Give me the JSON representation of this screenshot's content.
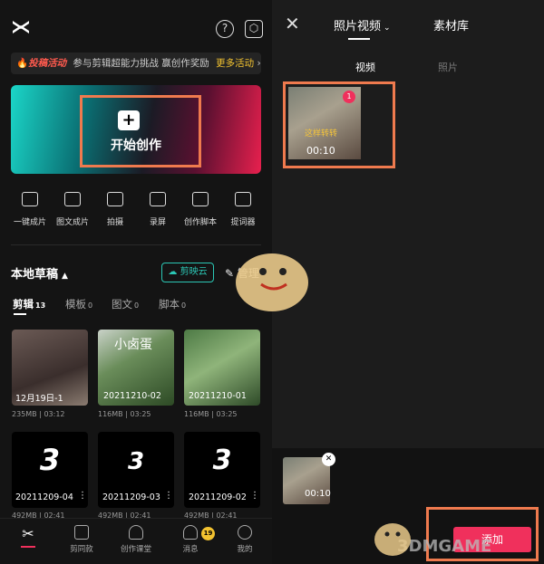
{
  "left": {
    "banner": {
      "tag": "投稿活动",
      "text": "参与剪辑超能力挑战 赢创作奖励",
      "more": "更多活动"
    },
    "hero": {
      "label": "开始创作"
    },
    "tools": [
      "一键成片",
      "图文成片",
      "拍摄",
      "录屏",
      "创作脚本",
      "提词器"
    ],
    "section_title": "本地草稿",
    "cloud_button": "剪映云",
    "manage_button": "管理",
    "subtabs": [
      {
        "label": "剪辑",
        "count": "13"
      },
      {
        "label": "模板",
        "count": "0"
      },
      {
        "label": "图文",
        "count": "0"
      },
      {
        "label": "脚本",
        "count": "0"
      }
    ],
    "drafts": [
      {
        "label": "12月19日-1",
        "meta": "235MB | 03:12"
      },
      {
        "label": "20211210-02",
        "meta": "116MB | 03:25",
        "overlay": "小卤蛋"
      },
      {
        "label": "20211210-01",
        "meta": "116MB | 03:25"
      },
      {
        "label": "20211209-04",
        "meta": "492MB | 02:41",
        "glyph": "3"
      },
      {
        "label": "20211209-03",
        "meta": "492MB | 02:41",
        "glyph": "3"
      },
      {
        "label": "20211209-02",
        "meta": "492MB | 02:41",
        "glyph": "3"
      }
    ],
    "nav": [
      {
        "label": ""
      },
      {
        "label": "剪同款"
      },
      {
        "label": "创作课堂"
      },
      {
        "label": "消息"
      },
      {
        "label": "我的"
      }
    ],
    "badge_count": "19",
    "accent": "#ef7a4e"
  },
  "right": {
    "tabs": [
      "照片视频",
      "素材库"
    ],
    "subtabs": [
      "视频",
      "照片"
    ],
    "clip": {
      "duration": "00:10",
      "index": "1",
      "caption": "这样转转"
    },
    "tray_clip": {
      "duration": "00:10"
    },
    "add_button": "添加",
    "watermark": "3DMGAME"
  }
}
